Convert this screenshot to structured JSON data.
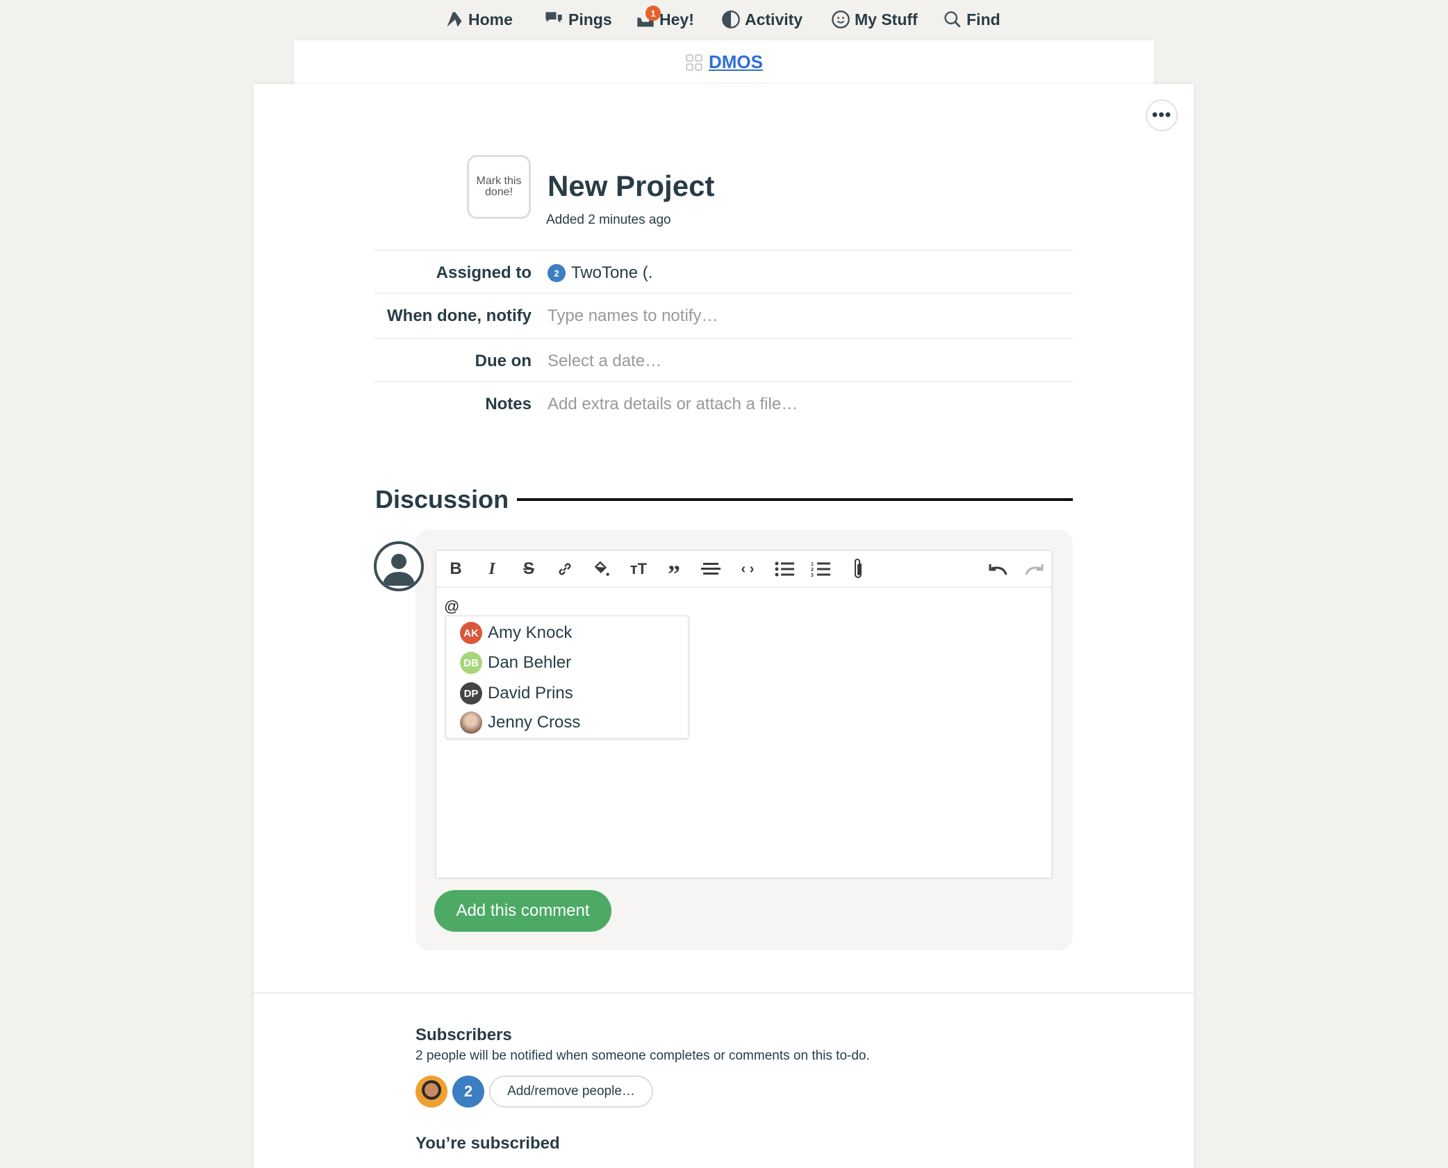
{
  "nav": {
    "items": [
      {
        "label": "Home",
        "icon": "home-icon"
      },
      {
        "label": "Pings",
        "icon": "pings-icon"
      },
      {
        "label": "Hey!",
        "icon": "hey-icon",
        "badge": "1"
      },
      {
        "label": "Activity",
        "icon": "activity-icon"
      },
      {
        "label": "My Stuff",
        "icon": "my-stuff-icon"
      },
      {
        "label": "Find",
        "icon": "search-icon"
      }
    ]
  },
  "breadcrumb": {
    "project": "DMOS"
  },
  "todo": {
    "mark_done": "Mark this done!",
    "title": "New Project",
    "added": "Added 2 minutes ago",
    "fields": [
      {
        "label": "Assigned to",
        "value": "TwoTone (."
      },
      {
        "label": "When done, notify",
        "placeholder": "Type names to notify…"
      },
      {
        "label": "Due on",
        "placeholder": "Select a date…"
      },
      {
        "label": "Notes",
        "placeholder": "Add extra details or attach a file…"
      }
    ]
  },
  "discussion": {
    "heading": "Discussion",
    "editor_text": "@",
    "mentions": [
      {
        "initials": "AK",
        "name": "Amy Knock",
        "color": "#d9573b"
      },
      {
        "initials": "DB",
        "name": "Dan Behler",
        "color": "#a8d57a"
      },
      {
        "initials": "DP",
        "name": "David Prins",
        "color": "#444444"
      },
      {
        "initials": "",
        "name": "Jenny Cross",
        "color": "#b89c8a"
      }
    ],
    "submit_label": "Add this comment"
  },
  "subscribers": {
    "heading": "Subscribers",
    "description": "2 people will be notified when someone completes or comments on this to-do.",
    "add_remove_label": "Add/remove people…",
    "status": "You’re subscribed"
  },
  "colors": {
    "accent": "#2f6fd6",
    "green": "#4caa65",
    "badge": "#e8612c"
  }
}
